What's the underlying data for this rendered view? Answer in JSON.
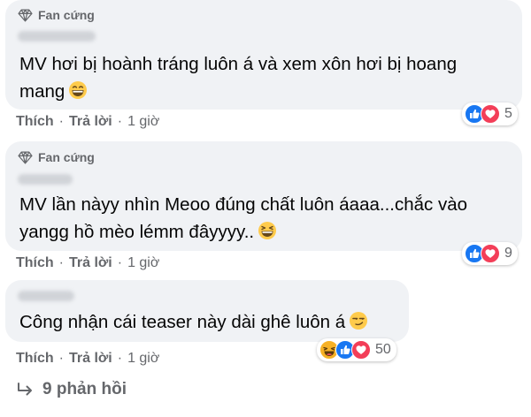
{
  "comments": [
    {
      "badge": "Fan cứng",
      "text_line1": "MV hơi bị hoành tráng luôn á và xem xôn hơi bị hoang",
      "text_line2": "mang",
      "emoji": "grinning-face-icon",
      "like_label": "Thích",
      "reply_label": "Trả lời",
      "time": "1 giờ",
      "reactions": [
        "like-icon",
        "love-icon"
      ],
      "reaction_count": "5"
    },
    {
      "badge": "Fan cứng",
      "text_line1": "MV lần nàyy nhìn Meoo đúng chất luôn áaaa...chắc vào",
      "text_line2": "yangg hồ mèo lémm đâyyyy..",
      "emoji": "laughing-face-icon",
      "like_label": "Thích",
      "reply_label": "Trả lời",
      "time": "1 giờ",
      "reactions": [
        "like-icon",
        "love-icon"
      ],
      "reaction_count": "9"
    },
    {
      "text_line1": "Công nhận cái teaser này dài ghê luôn á",
      "emoji": "smirking-face-icon",
      "like_label": "Thích",
      "reply_label": "Trả lời",
      "time": "1 giờ",
      "reactions": [
        "haha-icon",
        "like-icon",
        "love-icon"
      ],
      "reaction_count": "50"
    }
  ],
  "replies_label": "9 phản hồi",
  "colors": {
    "bubble": "#f0f2f5",
    "meta": "#65676b",
    "like_blue": "#1877f2",
    "love_red": "#f33e58",
    "haha_yellow": "#f7b125"
  }
}
